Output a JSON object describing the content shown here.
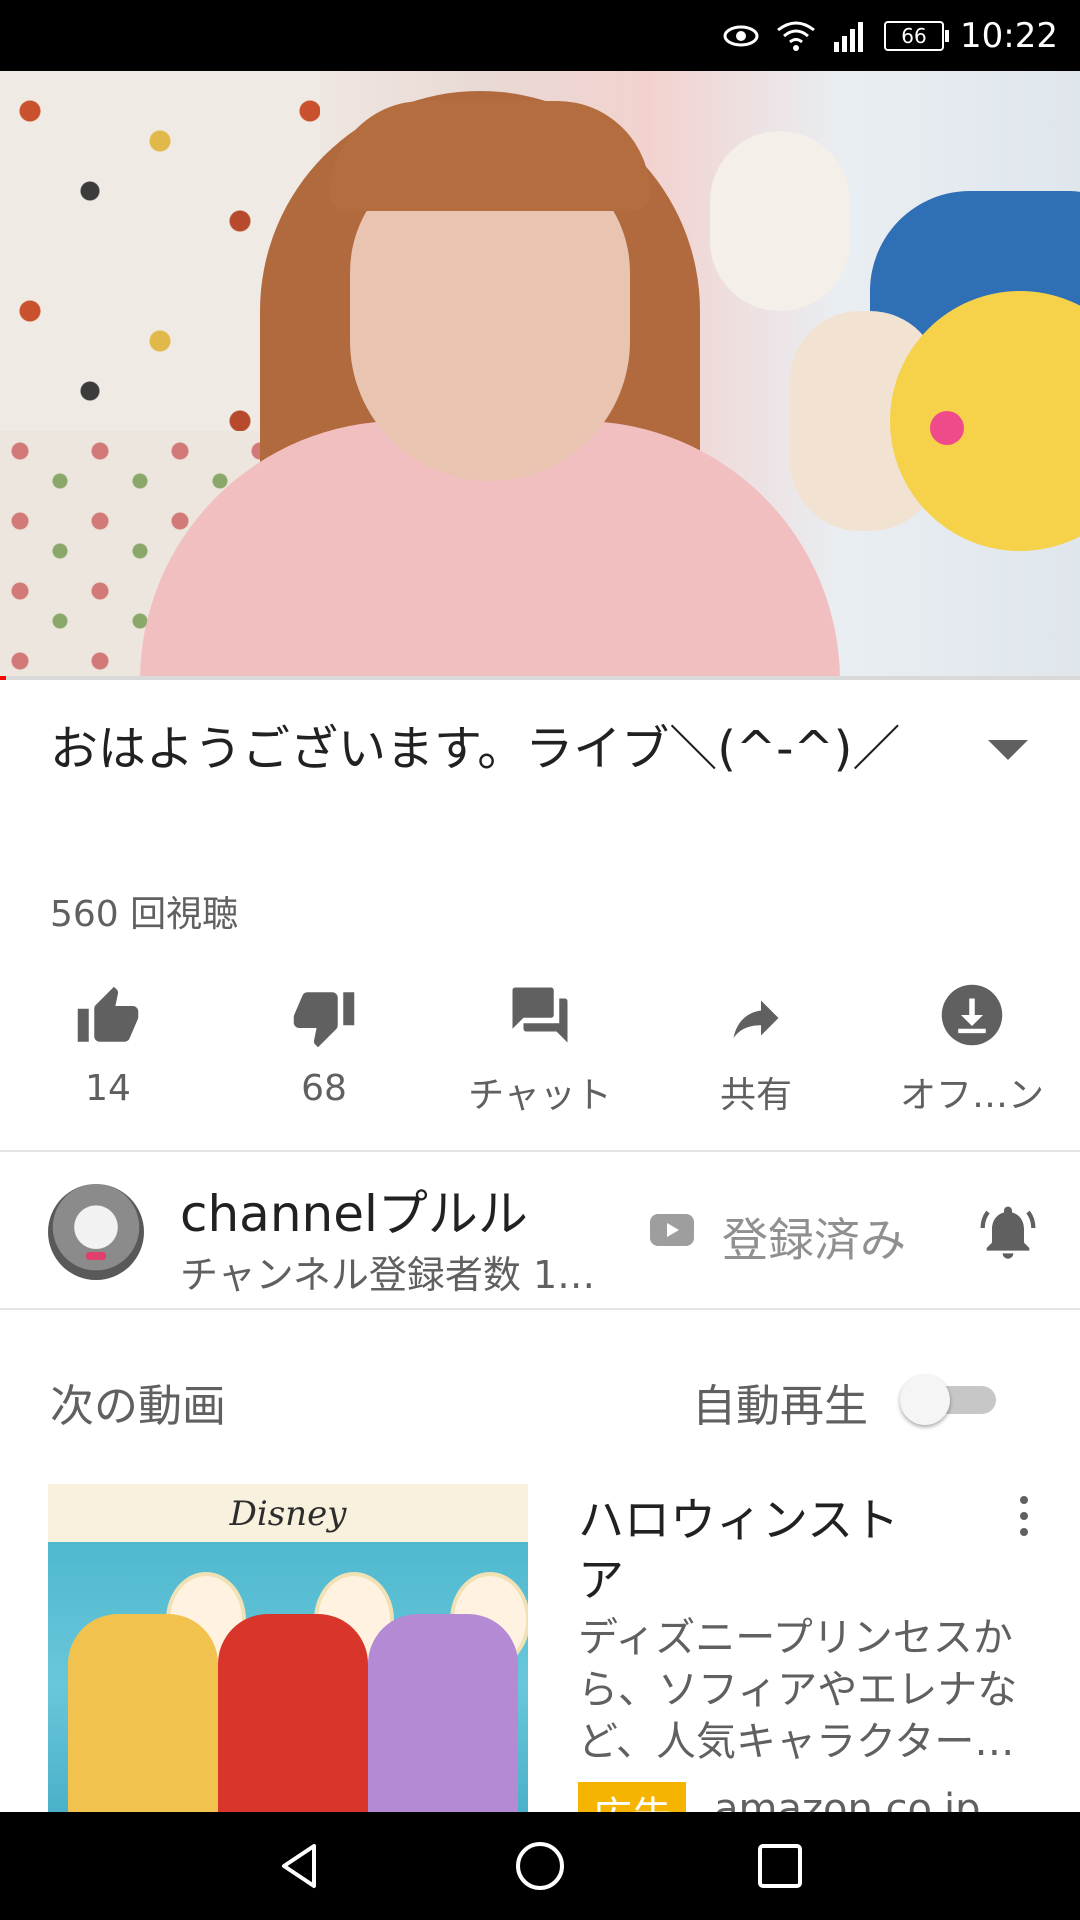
{
  "status_bar": {
    "time": "10:22",
    "battery": "66"
  },
  "video": {
    "progress": 0.006
  },
  "title": "おはようございます。ライブ＼(^-^)／",
  "views": "560 回視聴",
  "actions": [
    {
      "icon": "thumbs-up-icon",
      "label": "14"
    },
    {
      "icon": "thumbs-down-icon",
      "label": "68"
    },
    {
      "icon": "chat-icon",
      "label": "チャット"
    },
    {
      "icon": "share-icon",
      "label": "共有"
    },
    {
      "icon": "download-icon",
      "label": "オフ…ン"
    }
  ],
  "channel": {
    "name": "channelプルル",
    "subscribers": "チャンネル登録者数 1…",
    "subscribed_label": "登録済み"
  },
  "up_next": {
    "label": "次の動画",
    "autoplay_label": "自動再生",
    "autoplay_on": false
  },
  "ad": {
    "thumb_brand": "Disney",
    "title": "ハロウィンストア",
    "description": "ディズニープリンセスから、ソフィアやエレナなど、人気キャラクター…",
    "badge": "広告",
    "site": "amazon.co.jp"
  },
  "colors": {
    "accent": "#ff0000",
    "ad_badge": "#f4b400",
    "icon_gray": "#606060"
  }
}
